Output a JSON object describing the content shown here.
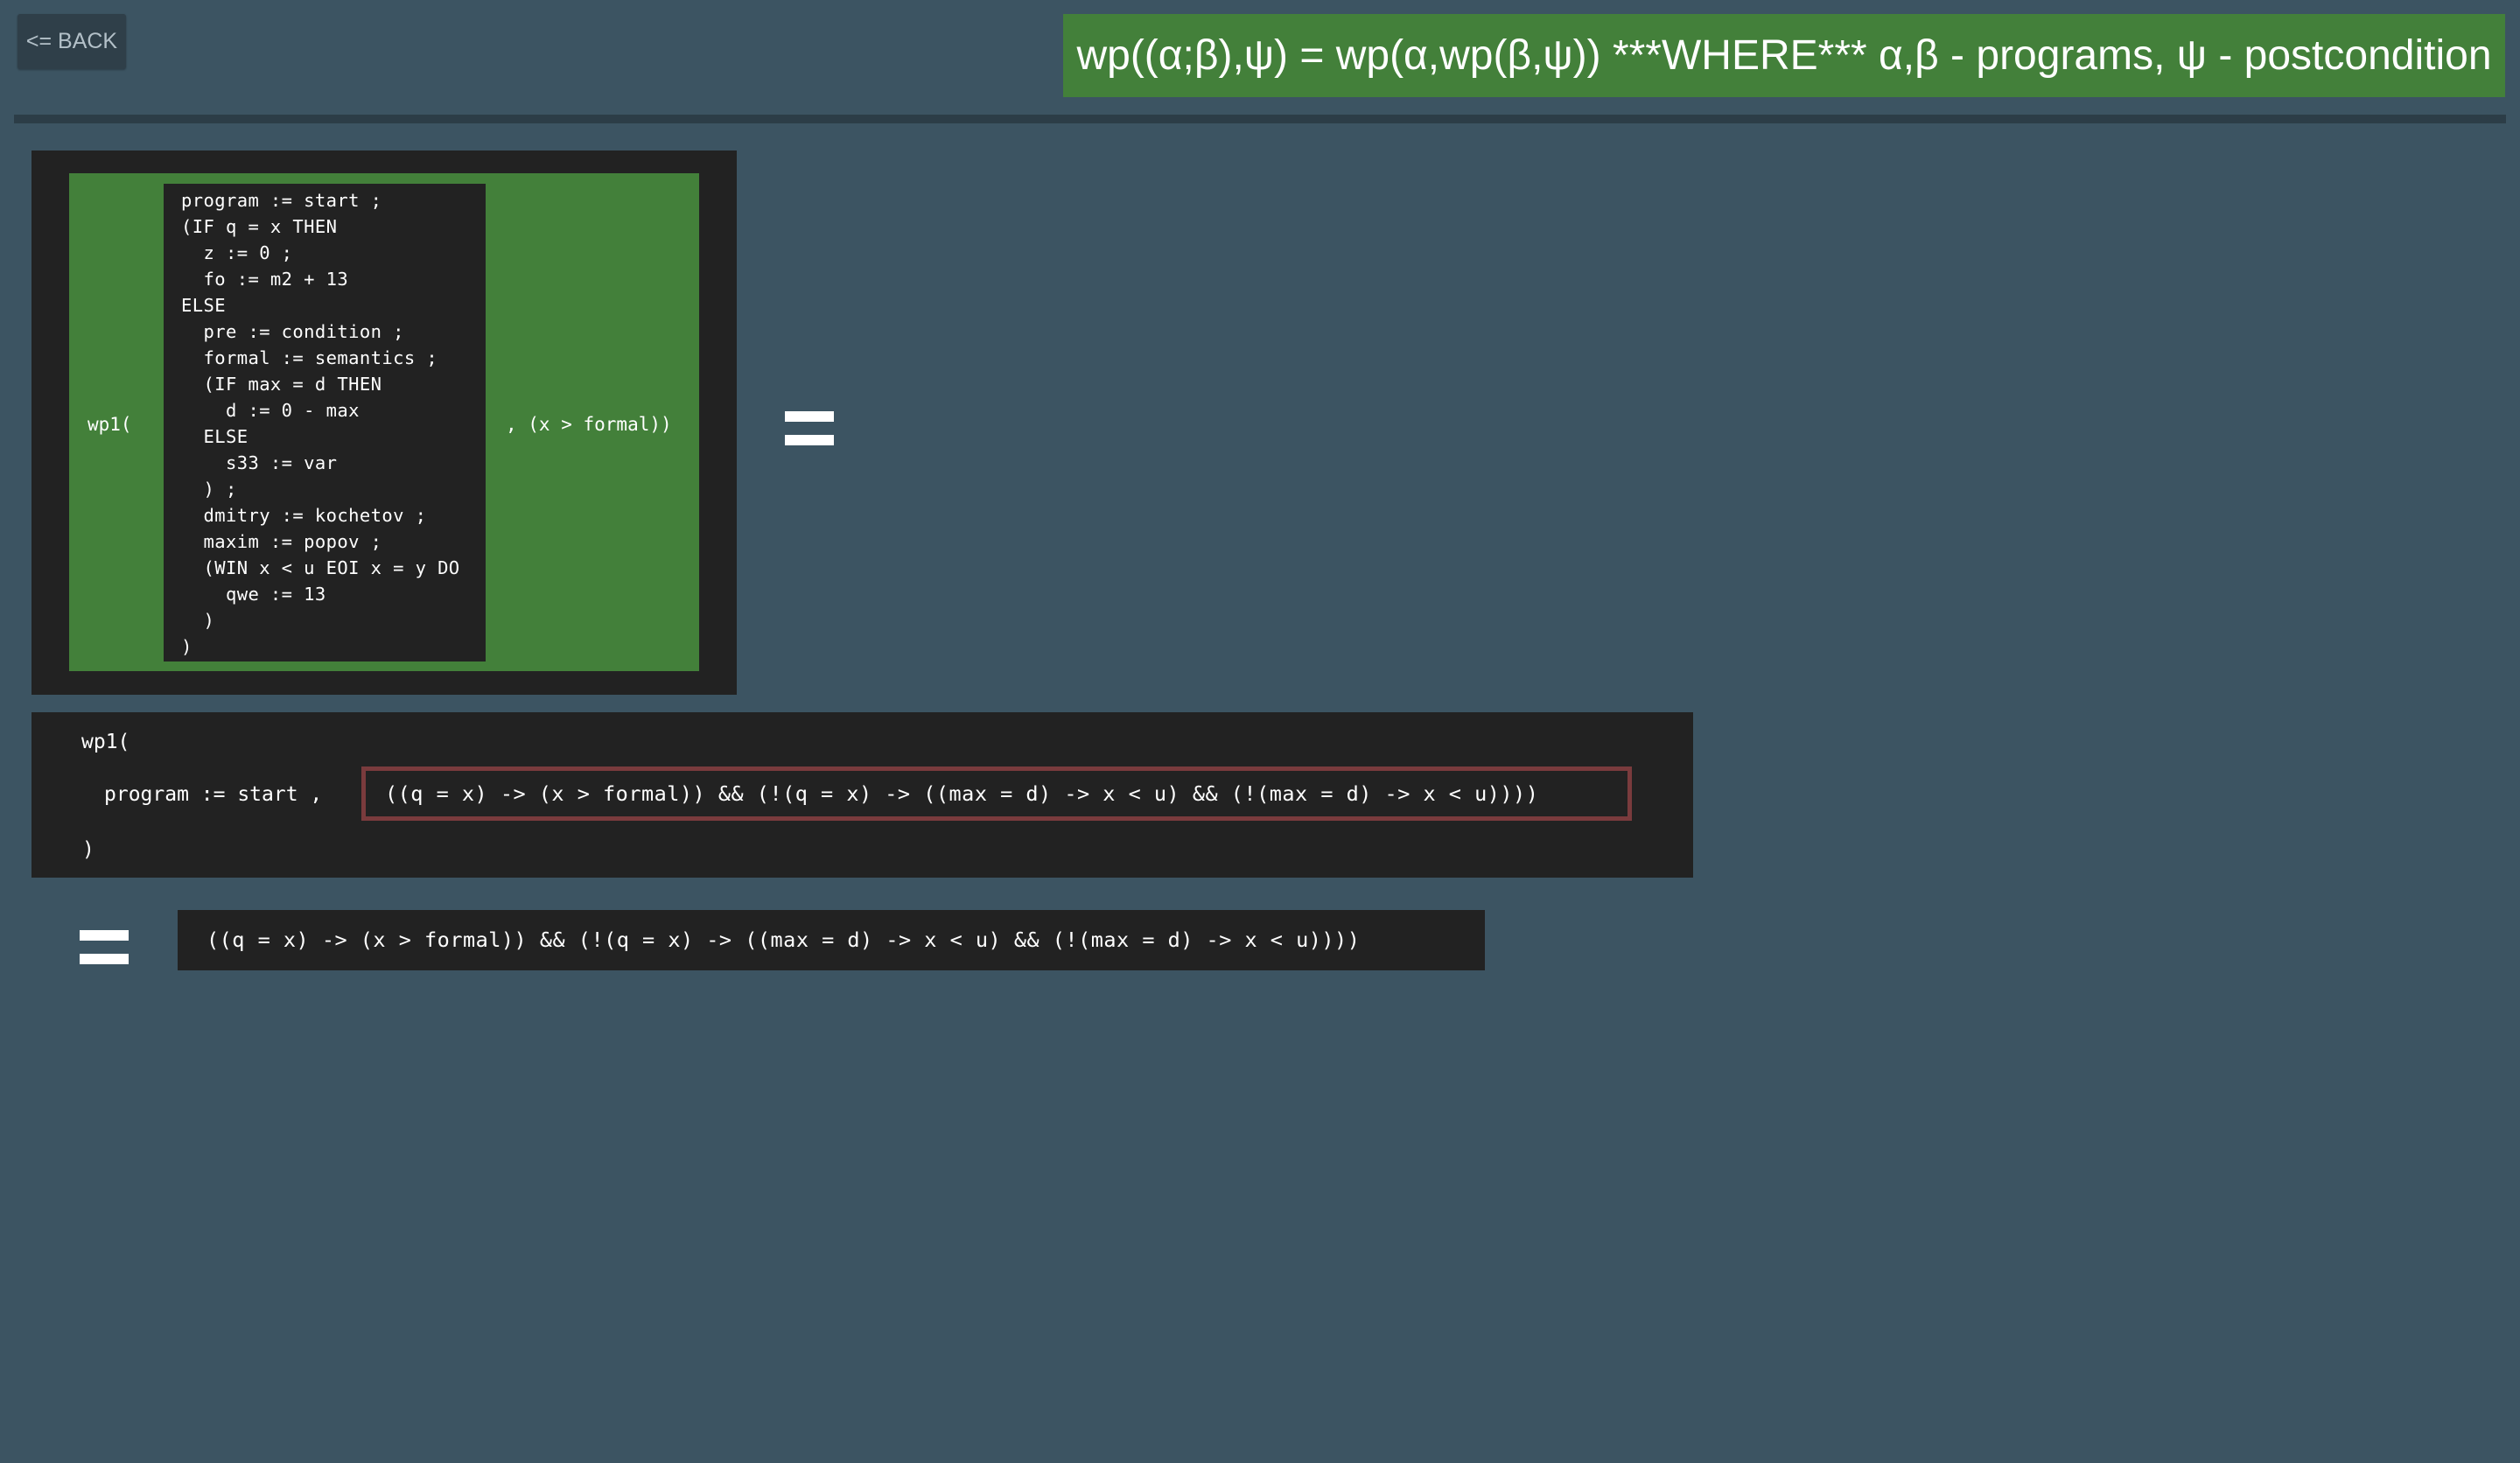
{
  "header": {
    "back_label": "<= BACK",
    "rule_text": "wp((α;β),ψ) = wp(α,wp(β,ψ)) ***WHERE*** α,β - programs, ψ - postcondition"
  },
  "wp_expression": {
    "function_label": "wp1(",
    "postcondition_label": ", (x > formal))",
    "program_lines": [
      "program := start ;",
      "(IF q = x THEN",
      "  z := 0 ;",
      "  fo := m2 + 13",
      "ELSE",
      "  pre := condition ;",
      "  formal := semantics ;",
      "  (IF max = d THEN",
      "    d := 0 - max",
      "  ELSE",
      "    s33 := var",
      "  ) ;",
      "  dmitry := kochetov ;",
      "  maxim := popov ;",
      "  (WIN x < u EOI x = y DO",
      "    qwe := 13",
      "  )",
      ")"
    ]
  },
  "step": {
    "open_label": "wp1(",
    "program_label": "program := start ,",
    "highlighted_condition": "((q = x) -> (x > formal)) && (!(q = x) -> ((max = d) -> x < u) && (!(max = d) -> x < u))))",
    "close_label": ")"
  },
  "result": {
    "text": "((q = x) -> (x > formal)) && (!(q = x) -> ((max = d) -> x < u) && (!(max = d) -> x < u))))"
  },
  "colors": {
    "background": "#3c5462",
    "accent_green": "#43803a",
    "panel_dark": "#222222",
    "highlight_border": "#7a3b3d"
  }
}
